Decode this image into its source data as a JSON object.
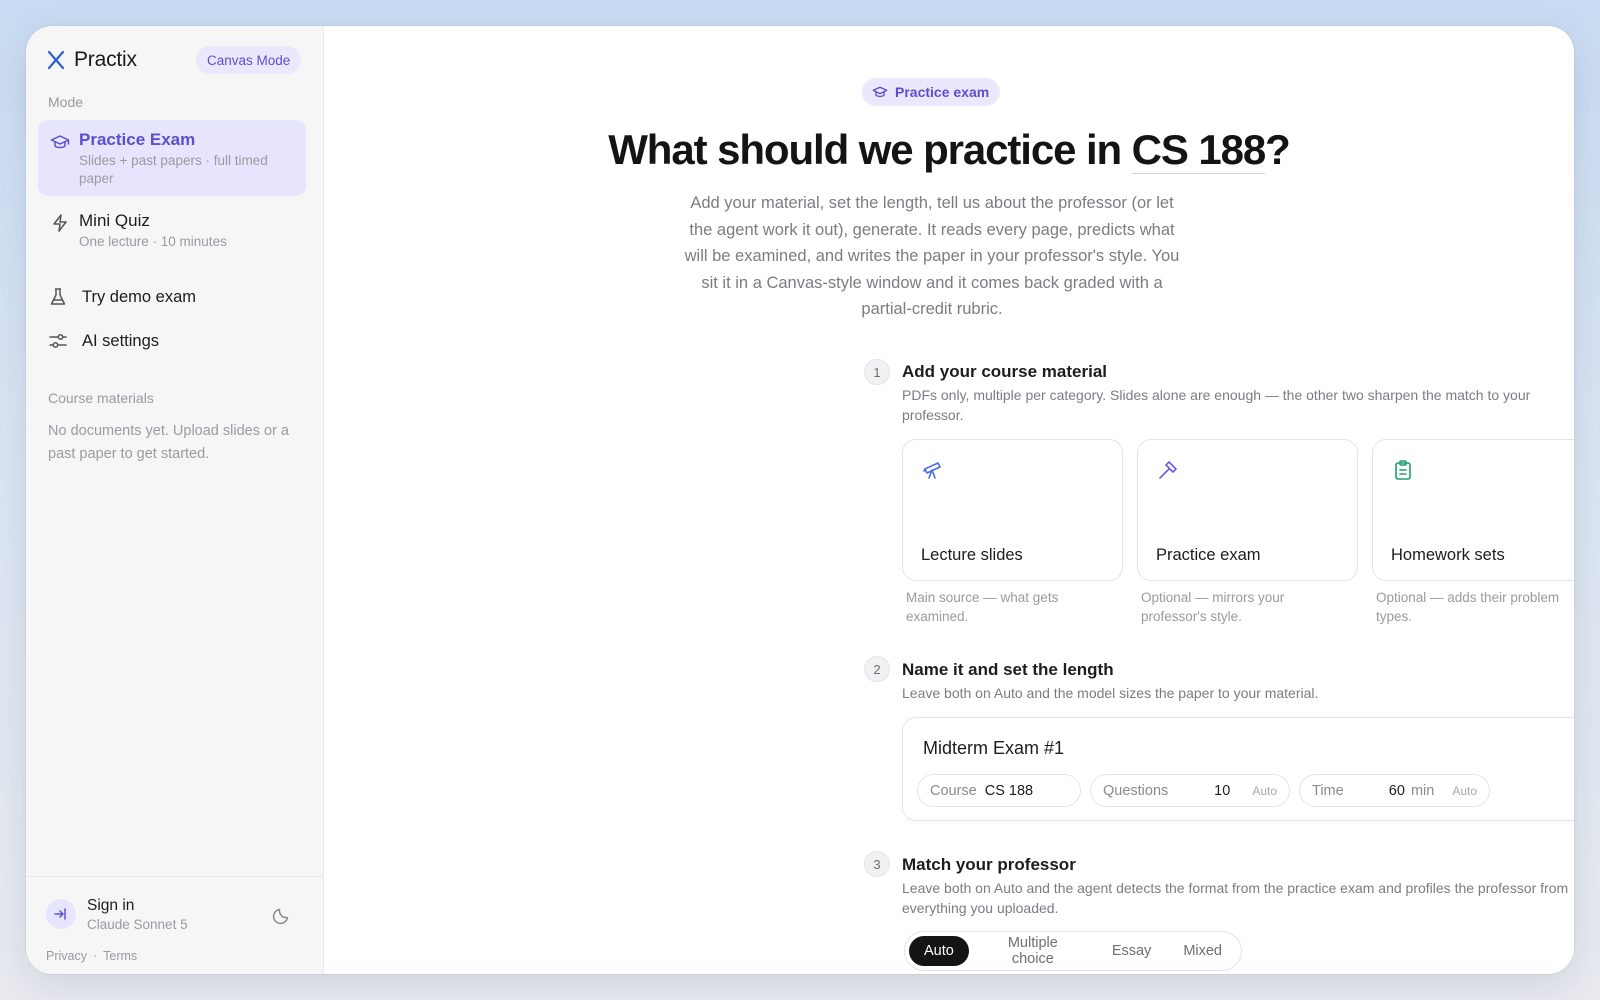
{
  "app": {
    "name": "Practix",
    "canvas_mode_label": "Canvas Mode"
  },
  "sidebar": {
    "mode_label": "Mode",
    "modes": [
      {
        "title": "Practice Exam",
        "subtitle": "Slides + past papers · full timed paper",
        "icon": "graduation-cap-icon",
        "active": true
      },
      {
        "title": "Mini Quiz",
        "subtitle": "One lecture · 10 minutes",
        "icon": "lightning-icon",
        "active": false
      }
    ],
    "links": [
      {
        "label": "Try demo exam",
        "icon": "flask-icon"
      },
      {
        "label": "AI settings",
        "icon": "sliders-icon"
      }
    ],
    "materials_label": "Course materials",
    "materials_empty": "No documents yet. Upload slides or a past paper to get started.",
    "footer": {
      "sign_in": "Sign in",
      "model": "Claude Sonnet 5",
      "privacy": "Privacy",
      "separator": "·",
      "terms": "Terms"
    }
  },
  "main": {
    "pill_label": "Practice exam",
    "headline_prefix": "What should we practice in",
    "headline_course": "CS 188",
    "headline_suffix": "?",
    "intro": "Add your material, set the length, tell us about the professor (or let the agent work it out), generate. It reads every page, predicts what will be examined, and writes the paper in your professor's style. You sit it in a Canvas-style window and it comes back graded with a partial-credit rubric.",
    "steps": [
      {
        "number": "1",
        "title": "Add your course material",
        "description": "PDFs only, multiple per category. Slides alone are enough — the other two sharpen the match to your professor."
      },
      {
        "number": "2",
        "title": "Name it and set the length",
        "description": "Leave both on Auto and the model sizes the paper to your material."
      },
      {
        "number": "3",
        "title": "Match your professor",
        "description": "Leave both on Auto and the agent detects the format from the practice exam and profiles the professor from everything you uploaded."
      }
    ],
    "materials": [
      {
        "title": "Lecture slides",
        "note": "Main source — what gets examined.",
        "icon": "telescope-icon",
        "color": "#4a6ee0"
      },
      {
        "title": "Practice exam",
        "note": "Optional — mirrors your professor's style.",
        "icon": "gavel-icon",
        "color": "#6c5ce7"
      },
      {
        "title": "Homework sets",
        "note": "Optional — adds their problem types.",
        "icon": "clipboard-icon",
        "color": "#1f9d6b"
      }
    ],
    "length": {
      "exam_name": "Midterm Exam #1",
      "course_label": "Course",
      "course_value": "CS 188",
      "questions_label": "Questions",
      "questions_value": "10",
      "questions_auto": "Auto",
      "time_label": "Time",
      "time_value": "60",
      "time_unit": "min",
      "time_auto": "Auto"
    },
    "format_options": [
      "Auto",
      "Multiple choice",
      "Essay",
      "Mixed"
    ],
    "format_selected": "Auto"
  },
  "colors": {
    "accent": "#5b4fcf",
    "accent_bg": "#ebe8fd",
    "sidebar_bg": "#f6f6f7"
  }
}
